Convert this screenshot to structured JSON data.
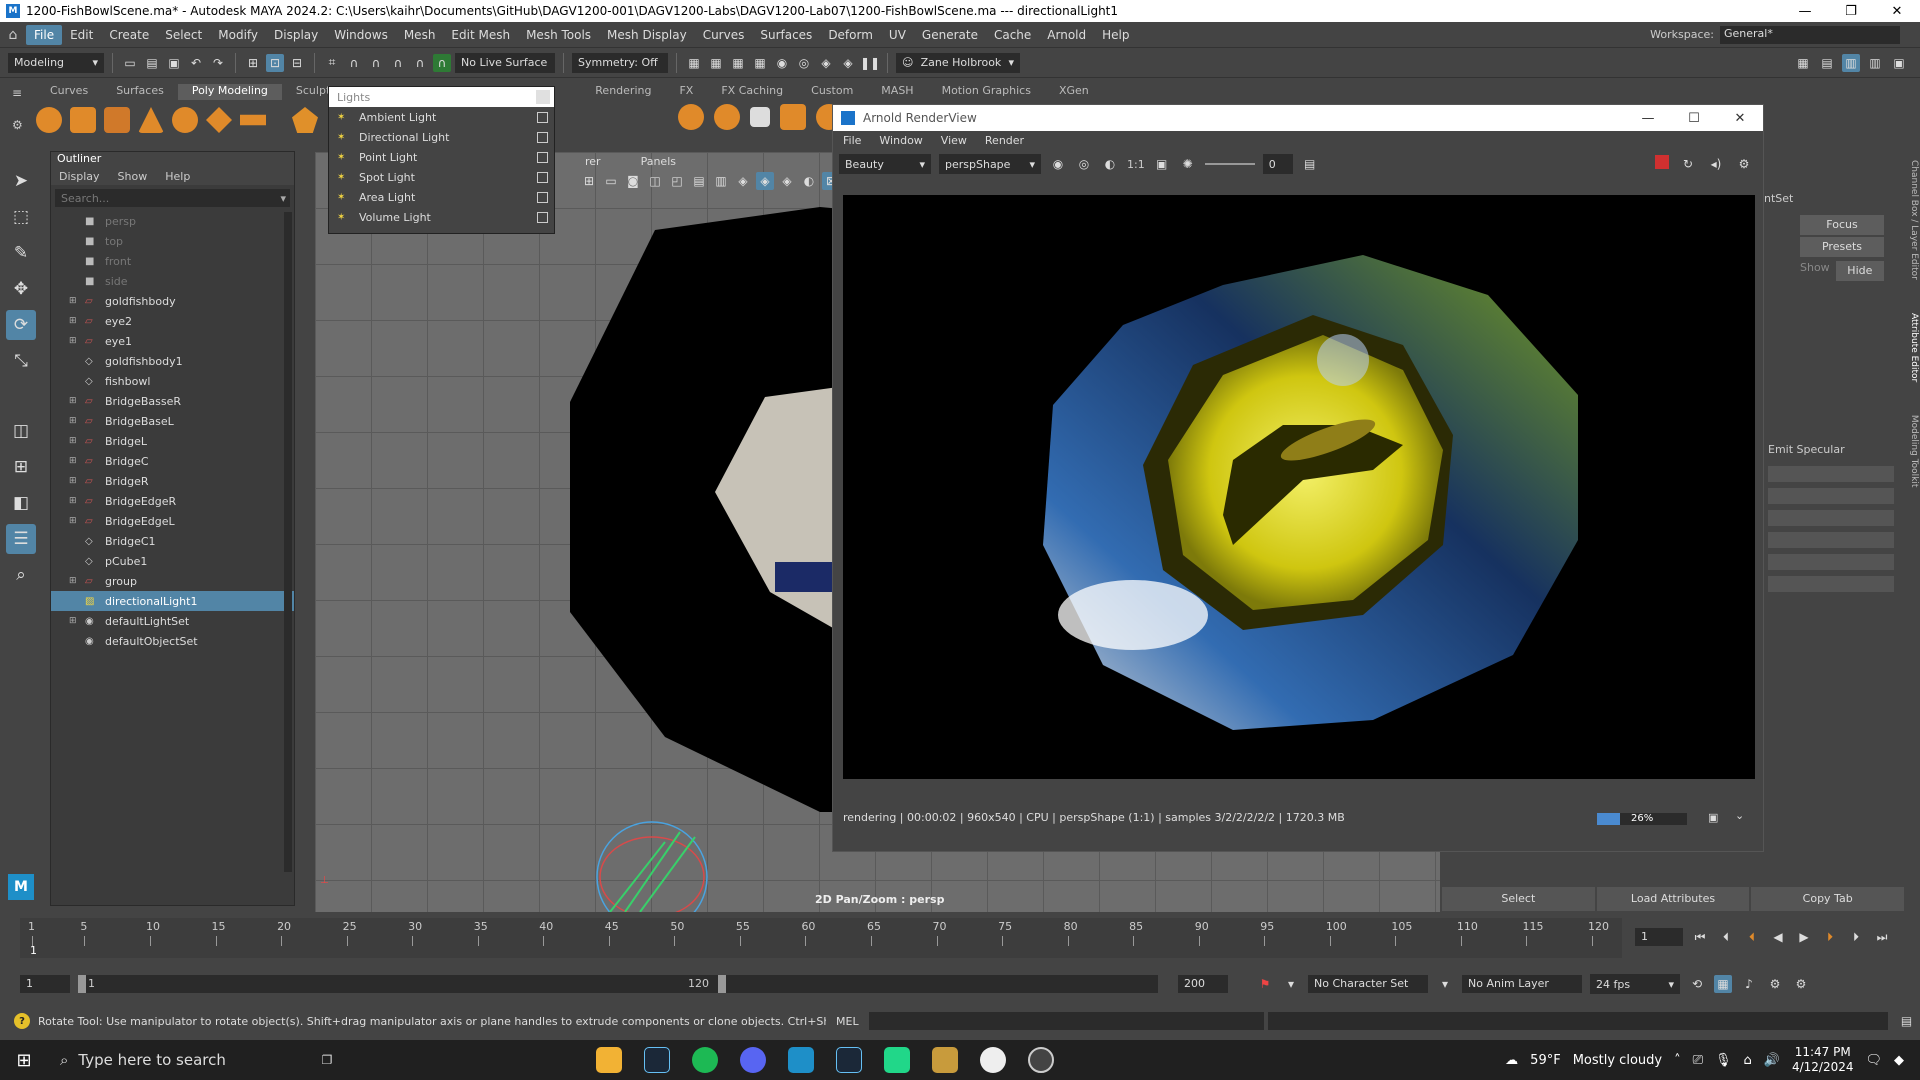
{
  "window": {
    "title": "1200-FishBowlScene.ma* - Autodesk MAYA 2024.2: C:\\Users\\kaihr\\Documents\\GitHub\\DAGV1200-001\\DAGV1200-Labs\\DAGV1200-Lab07\\1200-FishBowlScene.ma    ---    directionalLight1"
  },
  "menubar": {
    "items": [
      "File",
      "Edit",
      "Create",
      "Select",
      "Modify",
      "Display",
      "Windows",
      "Mesh",
      "Edit Mesh",
      "Mesh Tools",
      "Mesh Display",
      "Curves",
      "Surfaces",
      "Deform",
      "UV",
      "Generate",
      "Cache",
      "Arnold",
      "Help"
    ],
    "workspace_label": "Workspace:",
    "workspace_value": "General*"
  },
  "statusline": {
    "mode": "Modeling",
    "live_surface": "No Live Surface",
    "symmetry": "Symmetry: Off",
    "user": "Zane Holbrook"
  },
  "shelf": {
    "tabs": [
      "Curves",
      "Surfaces",
      "Poly Modeling",
      "Sculpting",
      "Rendering",
      "FX",
      "FX Caching",
      "Custom",
      "MASH",
      "Motion Graphics",
      "XGen"
    ]
  },
  "outliner": {
    "title": "Outliner",
    "menu": [
      "Display",
      "Show",
      "Help"
    ],
    "search_placeholder": "Search...",
    "items": [
      {
        "label": "persp",
        "kind": "cam"
      },
      {
        "label": "top",
        "kind": "cam"
      },
      {
        "label": "front",
        "kind": "cam"
      },
      {
        "label": "side",
        "kind": "cam"
      },
      {
        "label": "goldfishbody",
        "kind": "mesh"
      },
      {
        "label": "eye2",
        "kind": "mesh"
      },
      {
        "label": "eye1",
        "kind": "mesh"
      },
      {
        "label": "goldfishbody1",
        "kind": "shape"
      },
      {
        "label": "fishbowl",
        "kind": "shape"
      },
      {
        "label": "BridgeBasseR",
        "kind": "mesh"
      },
      {
        "label": "BridgeBaseL",
        "kind": "mesh"
      },
      {
        "label": "BridgeL",
        "kind": "mesh"
      },
      {
        "label": "BridgeC",
        "kind": "mesh"
      },
      {
        "label": "BridgeR",
        "kind": "mesh"
      },
      {
        "label": "BridgeEdgeR",
        "kind": "mesh"
      },
      {
        "label": "BridgeEdgeL",
        "kind": "mesh"
      },
      {
        "label": "BridgeC1",
        "kind": "shape"
      },
      {
        "label": "pCube1",
        "kind": "shape"
      },
      {
        "label": "group",
        "kind": "mesh"
      },
      {
        "label": "directionalLight1",
        "kind": "light"
      },
      {
        "label": "defaultLightSet",
        "kind": "set"
      },
      {
        "label": "defaultObjectSet",
        "kind": "set"
      }
    ]
  },
  "lights_menu": {
    "title": "Lights",
    "items": [
      "Ambient Light",
      "Directional Light",
      "Point Light",
      "Spot Light",
      "Area Light",
      "Volume Light"
    ]
  },
  "viewport": {
    "panels_label": "Panels",
    "renderer_label": "rer",
    "hud": "2D Pan/Zoom : persp"
  },
  "arnold": {
    "title": "Arnold RenderView",
    "menu": [
      "File",
      "Window",
      "View",
      "Render"
    ],
    "aov": "Beauty",
    "camera": "perspShape",
    "ratio": "1:1",
    "exposure": "0",
    "status": "rendering | 00:00:02 | 960x540 | CPU | perspShape (1:1) | samples 3/2/2/2/2/2 | 1720.3 MB",
    "progress_label": "26%",
    "progress": 0.26
  },
  "right_panel": {
    "partial_label": "ntSet",
    "focus": "Focus",
    "presets": "Presets",
    "show": "Show",
    "hide": "Hide",
    "emit_specular": "Emit Specular",
    "side_tabs": [
      "Channel Box / Layer Editor",
      "Attribute Editor",
      "Modeling Toolkit"
    ],
    "bottom_buttons": [
      "Select",
      "Load Attributes",
      "Copy Tab"
    ]
  },
  "timeslider": {
    "ticks": [
      "1",
      "5",
      "10",
      "15",
      "20",
      "25",
      "30",
      "35",
      "40",
      "45",
      "50",
      "55",
      "60",
      "65",
      "70",
      "75",
      "80",
      "85",
      "90",
      "95",
      "100",
      "105",
      "110",
      "115",
      "120"
    ],
    "current_frame": "1",
    "range_start": "1",
    "range_inner_start": "1",
    "range_inner_end": "120",
    "range_end": "200",
    "character_set": "No Character Set",
    "anim_layer": "No Anim Layer",
    "fps": "24 fps"
  },
  "helpline": {
    "text": "Rotate Tool: Use manipulator to rotate object(s). Shift+drag manipulator axis or plane handles to extrude components or clone objects. Ctrl+Shift+LMB+drag to constrain rotatio",
    "mel": "MEL"
  },
  "taskbar": {
    "search_placeholder": "Type here to search",
    "weather_temp": "59°F",
    "weather_desc": "Mostly cloudy",
    "time": "11:47 PM",
    "date": "4/12/2024"
  }
}
